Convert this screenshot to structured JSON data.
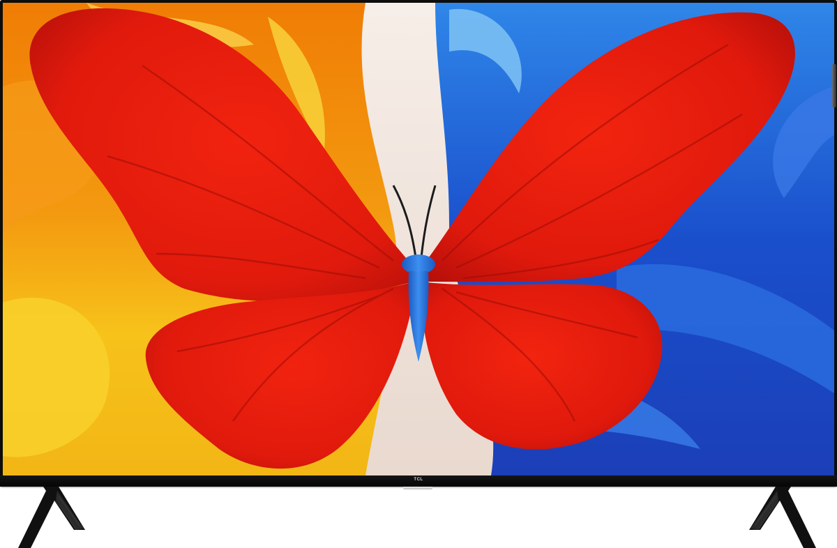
{
  "product": {
    "brand_logo": "TCL"
  },
  "colors": {
    "bezel": "#0d0d0d",
    "wing_red": "#e51a0d",
    "paint_orange": "#f58a0a",
    "paint_yellow": "#f7c21a",
    "paint_blue": "#1f5fd6",
    "butterfly_body": "#2d7ce0",
    "background_cream": "#f2e7df"
  },
  "icons": {
    "stand_left": "tv-leg-icon",
    "stand_right": "tv-leg-icon",
    "butterfly": "butterfly-artwork"
  }
}
